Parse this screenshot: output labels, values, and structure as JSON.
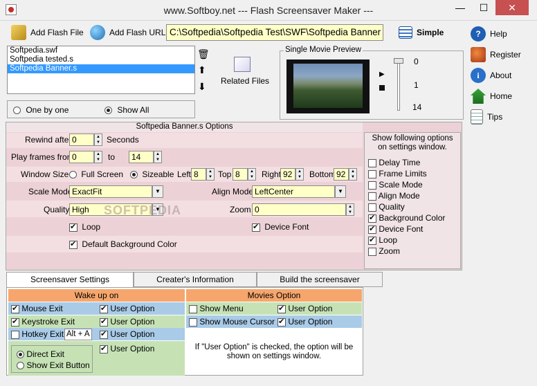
{
  "window": {
    "title": "www.Softboy.net  ---  Flash Screensaver Maker  ---",
    "minimize": "—",
    "maximize": "☐",
    "close": "✕"
  },
  "toolbar": {
    "add_flash_file": "Add Flash File",
    "add_flash_url": "Add Flash URL",
    "path_value": "C:\\Softpedia\\Softpedia Test\\SWF\\Softpedia Banner",
    "simple": "Simple"
  },
  "sidebar": {
    "items": [
      {
        "label": "Help",
        "icon": "help-icon"
      },
      {
        "label": "Register",
        "icon": "register-icon"
      },
      {
        "label": "About",
        "icon": "about-icon"
      },
      {
        "label": "Home",
        "icon": "home-icon"
      },
      {
        "label": "Tips",
        "icon": "tips-icon"
      }
    ]
  },
  "files": {
    "items": [
      "Softpedia.swf",
      "Softpedia tested.s",
      "Softpedia Banner.s"
    ],
    "selected_index": 2,
    "related_files": "Related Files"
  },
  "play_mode": {
    "one_by_one": "One by one",
    "show_all": "Show All",
    "selected": "show_all"
  },
  "preview": {
    "label": "Single Movie Preview",
    "slider_top": "0",
    "slider_mid": "1",
    "slider_bottom": "14"
  },
  "options": {
    "header": "Softpedia Banner.s Options",
    "rewind_label": "Rewind after",
    "rewind_value": "0",
    "seconds": "Seconds",
    "play_frames_label": "Play frames from",
    "frames_from": "0",
    "to_label": "to",
    "frames_to": "14",
    "window_size_label": "Window Size",
    "full_screen": "Full Screen",
    "sizeable": "Sizeable",
    "left_label": "Left",
    "left_value": "8",
    "top_label": "Top",
    "top_value": "8",
    "right_label": "Right",
    "right_value": "92",
    "bottom_label": "Bottom",
    "bottom_value": "92",
    "scale_mode_label": "Scale Mode",
    "scale_mode_value": "ExactFit",
    "align_mode_label": "Align Mode",
    "align_mode_value": "LeftCenter",
    "quality_label": "Quality",
    "quality_value": "High",
    "zoom_label": "Zoom",
    "zoom_value": "0",
    "loop": "Loop",
    "device_font": "Device Font",
    "default_bg": "Default Background Color",
    "watermark": "SOFTPEDIA"
  },
  "show_options": {
    "title": "Show following options on settings window.",
    "items": [
      {
        "label": "Delay Time",
        "checked": false
      },
      {
        "label": "Frame Limits",
        "checked": false
      },
      {
        "label": "Scale Mode",
        "checked": false
      },
      {
        "label": "Align Mode",
        "checked": false
      },
      {
        "label": "Quality",
        "checked": false
      },
      {
        "label": "Background Color",
        "checked": true
      },
      {
        "label": "Device Font",
        "checked": true
      },
      {
        "label": "Loop",
        "checked": true
      },
      {
        "label": "Zoom",
        "checked": false
      }
    ]
  },
  "tabs": [
    "Screensaver Settings",
    "Creater's Information",
    "Build the screensaver"
  ],
  "wake": {
    "header": "Wake up on",
    "mouse_exit": "Mouse Exit",
    "keystroke_exit": "Keystroke Exit",
    "hotkey_exit": "Hotkey Exit",
    "hotkey_value": "Alt + A",
    "user_option": "User Option",
    "direct_exit": "Direct Exit",
    "show_exit_button": "Show Exit Button"
  },
  "movies": {
    "header": "Movies Option",
    "show_menu": "Show Menu",
    "show_mouse_cursor": "Show Mouse Cursor",
    "user_option": "User Option",
    "note": "If \"User Option\" is checked,  the option will be shown on settings window."
  }
}
